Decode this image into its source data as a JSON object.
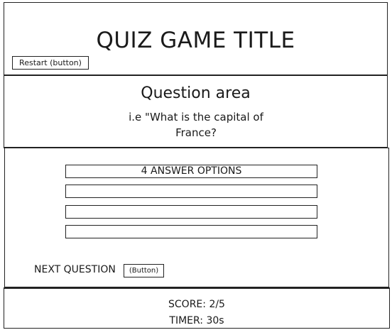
{
  "header": {
    "title": "QUIZ GAME TITLE",
    "restart_label": "Restart (button)"
  },
  "question": {
    "heading": "Question area",
    "text": "i.e \"What is the capital of\nFrance?"
  },
  "answers": {
    "options": [
      "4 ANSWER OPTIONS",
      "",
      "",
      ""
    ]
  },
  "next": {
    "label": "NEXT QUESTION",
    "button_label": "(Button)"
  },
  "footer": {
    "score": "SCORE: 2/5",
    "timer": "TIMER: 30s"
  }
}
